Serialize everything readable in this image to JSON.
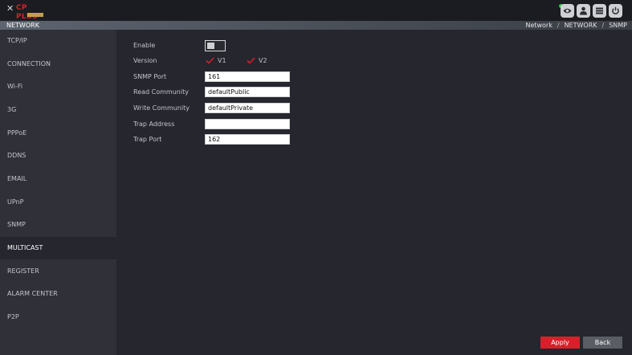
{
  "header": {
    "logo": {
      "mark": "✕",
      "word": "CP PLUS"
    },
    "icons": [
      "eye-icon",
      "user-icon",
      "menu-icon",
      "power-icon"
    ]
  },
  "titlebar": {
    "title": "NETWORK",
    "breadcrumb": [
      "Network",
      "NETWORK",
      "SNMP"
    ]
  },
  "sidebar": {
    "items": [
      {
        "label": "TCP/IP"
      },
      {
        "label": "CONNECTION"
      },
      {
        "label": "Wi-Fi"
      },
      {
        "label": "3G"
      },
      {
        "label": "PPPoE"
      },
      {
        "label": "DDNS"
      },
      {
        "label": "EMAIL"
      },
      {
        "label": "UPnP"
      },
      {
        "label": "SNMP"
      },
      {
        "label": "MULTICAST"
      },
      {
        "label": "REGISTER"
      },
      {
        "label": "ALARM CENTER"
      },
      {
        "label": "P2P"
      }
    ],
    "active": "SNMP"
  },
  "form": {
    "enable_label": "Enable",
    "enable_on": false,
    "version_label": "Version",
    "versions": [
      {
        "label": "V1",
        "checked": false
      },
      {
        "label": "V2",
        "checked": false
      }
    ],
    "snmp_port_label": "SNMP Port",
    "snmp_port": "161",
    "read_community_label": "Read Community",
    "read_community": "defaultPublic",
    "write_community_label": "Write Community",
    "write_community": "defaultPrivate",
    "trap_address_label": "Trap Address",
    "trap_address": "",
    "trap_port_label": "Trap Port",
    "trap_port": "162"
  },
  "buttons": {
    "apply": "Apply",
    "back": "Back"
  },
  "colors": {
    "accent": "#d81f2a",
    "background": "#25262e",
    "sidebar": "#2f3038",
    "status_online": "#2ad13a"
  }
}
